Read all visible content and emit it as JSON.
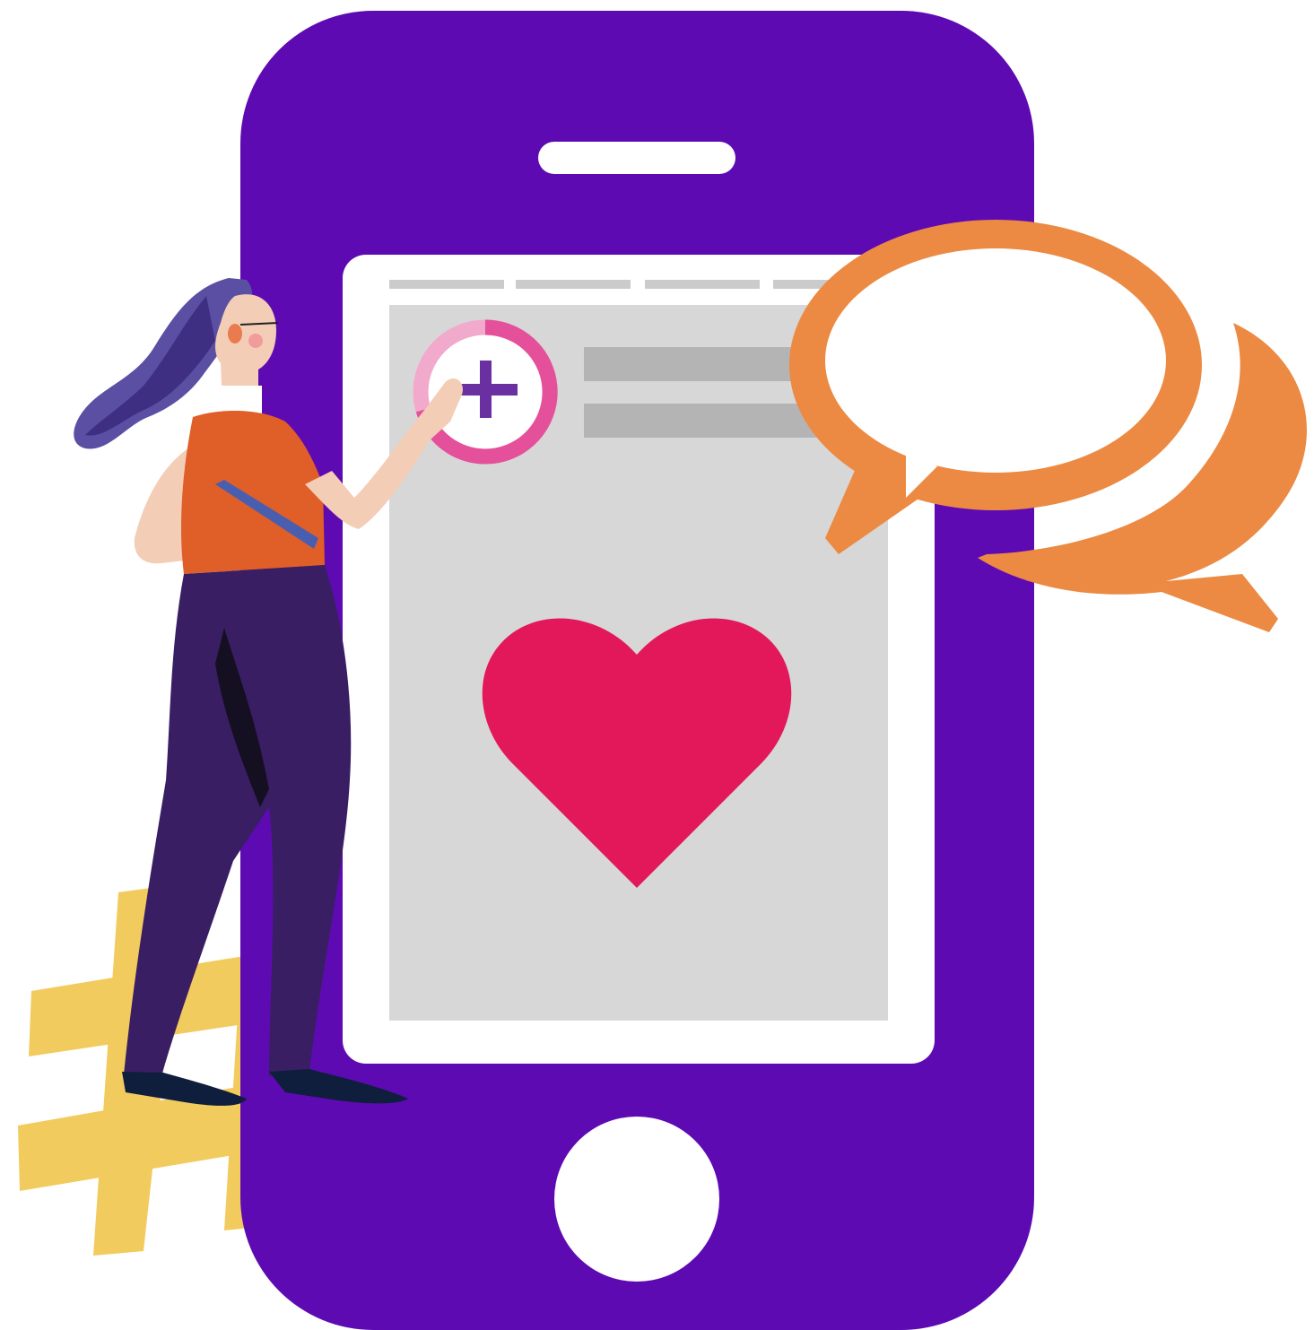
{
  "colors": {
    "background": "#ffffff",
    "phone_body": "#5e0ab3",
    "phone_screen_frame": "#ffffff",
    "screen_content": "#d7d7d7",
    "placeholder_bar": "#b4b4b4",
    "tab_bar": "#cbcbcb",
    "heart": "#e2185a",
    "add_ring": "#e4509a",
    "add_ring_light": "#f1a9cc",
    "plus_sign": "#6a2fa0",
    "speech_bubble": "#ec8a43",
    "hashtag": "#f2cb5e",
    "person_shirt": "#e05e28",
    "person_pants": "#3a1e63",
    "person_hair": "#5b4fa4",
    "person_skin": "#f3cdb6",
    "person_shoes": "#0e1e3c"
  },
  "icons": [
    "phone-icon",
    "heart-icon",
    "add-circle-icon",
    "speech-bubbles-icon",
    "hashtag-icon",
    "person-illustration",
    "home-button-icon"
  ]
}
